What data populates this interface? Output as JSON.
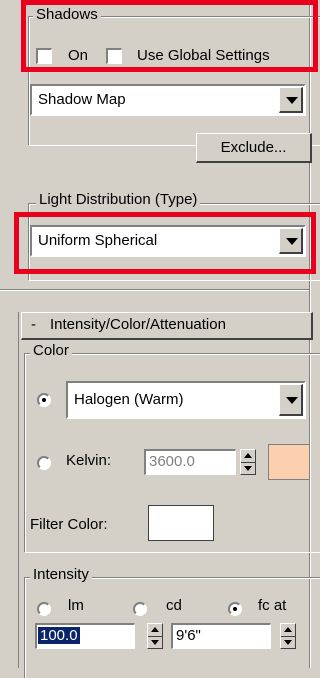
{
  "shadows": {
    "title": "Shadows",
    "on_label": "On",
    "global_label": "Use Global Settings",
    "type_value": "Shadow Map",
    "exclude_label": "Exclude..."
  },
  "distribution": {
    "title": "Light Distribution (Type)",
    "value": "Uniform Spherical"
  },
  "rollout": {
    "toggle": "-",
    "title": "Intensity/Color/Attenuation"
  },
  "color": {
    "title": "Color",
    "preset_value": "Halogen (Warm)",
    "kelvin_label": "Kelvin:",
    "kelvin_value": "3600.0",
    "kelvin_swatch": "#fccfae",
    "filter_label": "Filter Color:",
    "filter_swatch": "#ffffff"
  },
  "intensity": {
    "title": "Intensity",
    "unit_lm": "lm",
    "unit_cd": "cd",
    "unit_fc": "fc at",
    "selected_unit": "fc at",
    "value": "100.0",
    "distance": "9'6\""
  },
  "colors": {
    "highlight": "#e8001c",
    "selection": "#0a246a"
  }
}
